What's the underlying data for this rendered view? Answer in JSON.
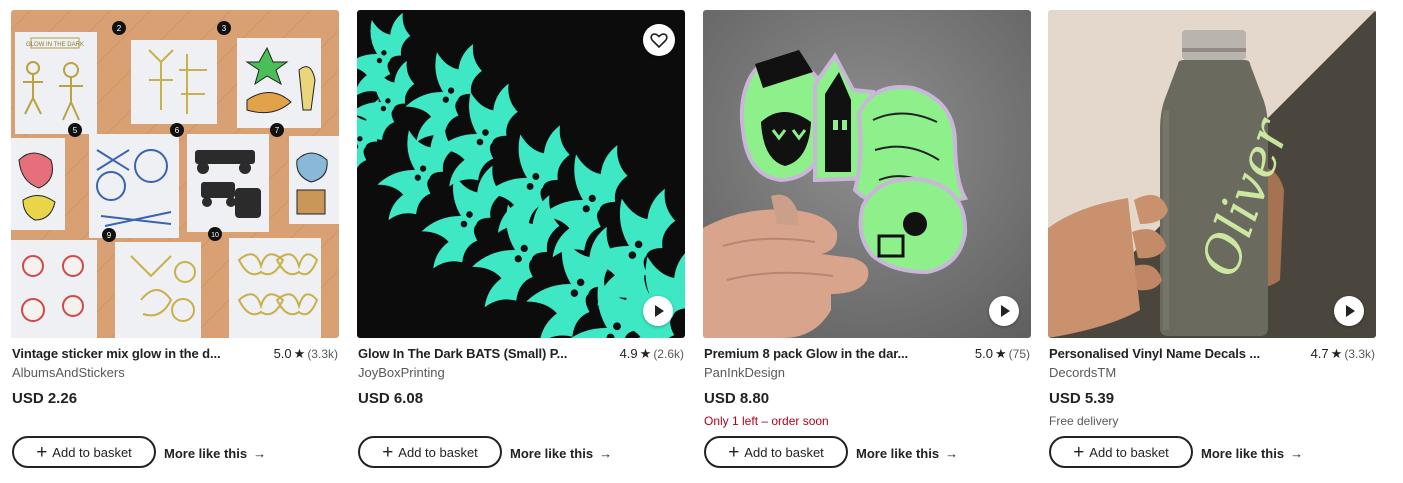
{
  "listings": [
    {
      "title": "Vintage sticker mix glow in the d...",
      "rating": "5.0",
      "reviews": "(3.3k)",
      "shop": "AlbumsAndStickers",
      "price": "USD 2.26",
      "note": "",
      "has_favorite": false,
      "image_numbers": [
        "2",
        "3",
        "5",
        "6",
        "7",
        "9",
        "10"
      ],
      "image_text": "GLOW IN THE DARK"
    },
    {
      "title": "Glow In The Dark BATS (Small) P...",
      "rating": "4.9",
      "reviews": "(2.6k)",
      "shop": "JoyBoxPrinting",
      "price": "USD 6.08",
      "note": "",
      "has_favorite": true
    },
    {
      "title": "Premium 8 pack Glow in the dar...",
      "rating": "5.0",
      "reviews": "(75)",
      "shop": "PanInkDesign",
      "price": "USD 8.80",
      "note": "Only 1 left – order soon",
      "has_favorite": false
    },
    {
      "title": "Personalised Vinyl Name Decals ...",
      "rating": "4.7",
      "reviews": "(3.3k)",
      "shop": "DecordsTM",
      "price": "USD 5.39",
      "note": "Free delivery",
      "has_favorite": false,
      "image_text": "Oliver"
    }
  ],
  "actions": {
    "add_to_basket": "Add to basket",
    "more_like_this": "More like this"
  },
  "icons": {
    "star": "star-icon",
    "play": "play-icon",
    "favorite": "heart-icon",
    "plus": "plus-icon",
    "arrow": "arrow-right-icon"
  },
  "colors": {
    "text": "#222222",
    "muted": "#595959",
    "scarcity": "#b3001e",
    "glow": "#3ee8c4"
  }
}
